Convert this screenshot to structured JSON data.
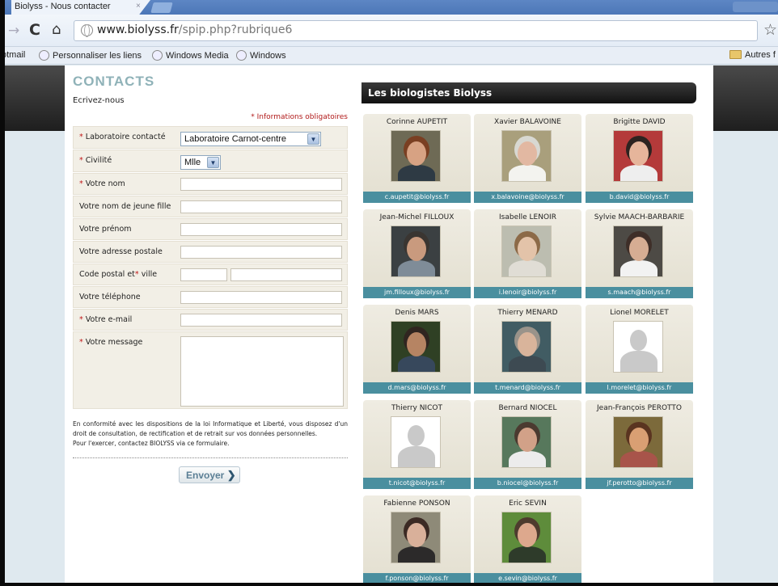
{
  "browser": {
    "tab_title": "Biolyss - Nous contacter",
    "tab_close": "×",
    "url_host": "www.biolyss.fr",
    "url_path": "/spip.php?rubrique6",
    "bookmarks": [
      {
        "label": "otmail"
      },
      {
        "label": "Personnaliser les liens"
      },
      {
        "label": "Windows Media"
      },
      {
        "label": "Windows"
      }
    ],
    "other_bookmarks": "Autres f"
  },
  "contact": {
    "title": "CONTACTS",
    "subtitle": "Ecrivez-nous",
    "required_note": "* Informations obligatoires",
    "fields": {
      "lab": {
        "label": "Laboratoire contacté",
        "required": true,
        "value": "Laboratoire Carnot-centre"
      },
      "civility": {
        "label": "Civilité",
        "required": true,
        "value": "Mlle"
      },
      "name": {
        "label": "Votre nom",
        "required": true
      },
      "maiden": {
        "label": "Votre nom de jeune fille"
      },
      "firstname": {
        "label": "Votre prénom"
      },
      "address": {
        "label": "Votre adresse postale"
      },
      "postal": {
        "label_a": "Code postal et",
        "label_b": "ville"
      },
      "phone": {
        "label": "Votre téléphone"
      },
      "email": {
        "label": "Votre e-mail",
        "required": true
      },
      "message": {
        "label": "Votre message",
        "required": true
      }
    },
    "req_mark": "*",
    "legal_1": "En conformité avec les dispositions de la loi Informatique et Liberté, vous disposez d'un droit de consultation, de rectification et de retrait sur vos données personnelles.",
    "legal_2": "Pour l'exercer, contactez BIOLYSS via ce formulaire.",
    "send_label": "Envoyer",
    "send_arrow": "❯"
  },
  "biologists": {
    "header": "Les biologistes Biolyss",
    "people": [
      {
        "name": "Corinne AUPETIT",
        "email": "c.aupetit@biolyss.fr",
        "photo": true,
        "skin": "#d7a283",
        "hair": "#7a3f22",
        "bg": "#6e6a55",
        "shirt": "#2e3a44"
      },
      {
        "name": "Xavier BALAVOINE",
        "email": "x.balavoine@biolyss.fr",
        "photo": true,
        "skin": "#e2b8a2",
        "hair": "#d8d8d2",
        "bg": "#a99f7c",
        "shirt": "#f3f3ef"
      },
      {
        "name": "Brigitte DAVID",
        "email": "b.david@biolyss.fr",
        "photo": true,
        "skin": "#e6b59b",
        "hair": "#2d2320",
        "bg": "#b43a3a",
        "shirt": "#eeeeee"
      },
      {
        "name": "Jean-Michel FILLOUX",
        "email": "jm.filloux@biolyss.fr",
        "photo": true,
        "skin": "#c99a7e",
        "hair": "#3a3531",
        "bg": "#3b4042",
        "shirt": "#7f8c98"
      },
      {
        "name": "Isabelle LENOIR",
        "email": "i.lenoir@biolyss.fr",
        "photo": true,
        "skin": "#e3c3a9",
        "hair": "#8c6a48",
        "bg": "#bcbdb0",
        "shirt": "#e0ddd5"
      },
      {
        "name": "Sylvie MAACH-BARBARIE",
        "email": "s.maach@biolyss.fr",
        "photo": true,
        "skin": "#d6ad93",
        "hair": "#3e2e28",
        "bg": "#4d4a45",
        "shirt": "#f2f2f2"
      },
      {
        "name": "Denis MARS",
        "email": "d.mars@biolyss.fr",
        "photo": true,
        "skin": "#b68463",
        "hair": "#302520",
        "bg": "#2f4024",
        "shirt": "#37485c"
      },
      {
        "name": "Thierry MENARD",
        "email": "t.menard@biolyss.fr",
        "photo": true,
        "skin": "#d9b49b",
        "hair": "#9a938a",
        "bg": "#415c63",
        "shirt": "#3d4a52"
      },
      {
        "name": "Lionel MORELET",
        "email": "l.morelet@biolyss.fr",
        "photo": false
      },
      {
        "name": "Thierry NICOT",
        "email": "t.nicot@biolyss.fr",
        "photo": false
      },
      {
        "name": "Bernard NIOCEL",
        "email": "b.niocel@biolyss.fr",
        "photo": true,
        "skin": "#d2a188",
        "hair": "#4b3a30",
        "bg": "#57785c",
        "shirt": "#ececec"
      },
      {
        "name": "Jean-François PEROTTO",
        "email": "jf.perotto@biolyss.fr",
        "photo": true,
        "skin": "#d99f73",
        "hair": "#5a3420",
        "bg": "#7c6a3b",
        "shirt": "#a8544a"
      },
      {
        "name": "Fabienne PONSON",
        "email": "f.ponson@biolyss.fr",
        "photo": true,
        "skin": "#d9b09a",
        "hair": "#3b2a24",
        "bg": "#8e8a78",
        "shirt": "#2c2a2a"
      },
      {
        "name": "Eric SEVIN",
        "email": "e.sevin@biolyss.fr",
        "photo": true,
        "skin": "#dda88d",
        "hair": "#4e3b2e",
        "bg": "#5e8c3b",
        "shirt": "#2e3b2a"
      }
    ]
  },
  "colors": {
    "accent": "#4a8f9f",
    "title": "#8fb2b8",
    "required": "#c01818"
  }
}
